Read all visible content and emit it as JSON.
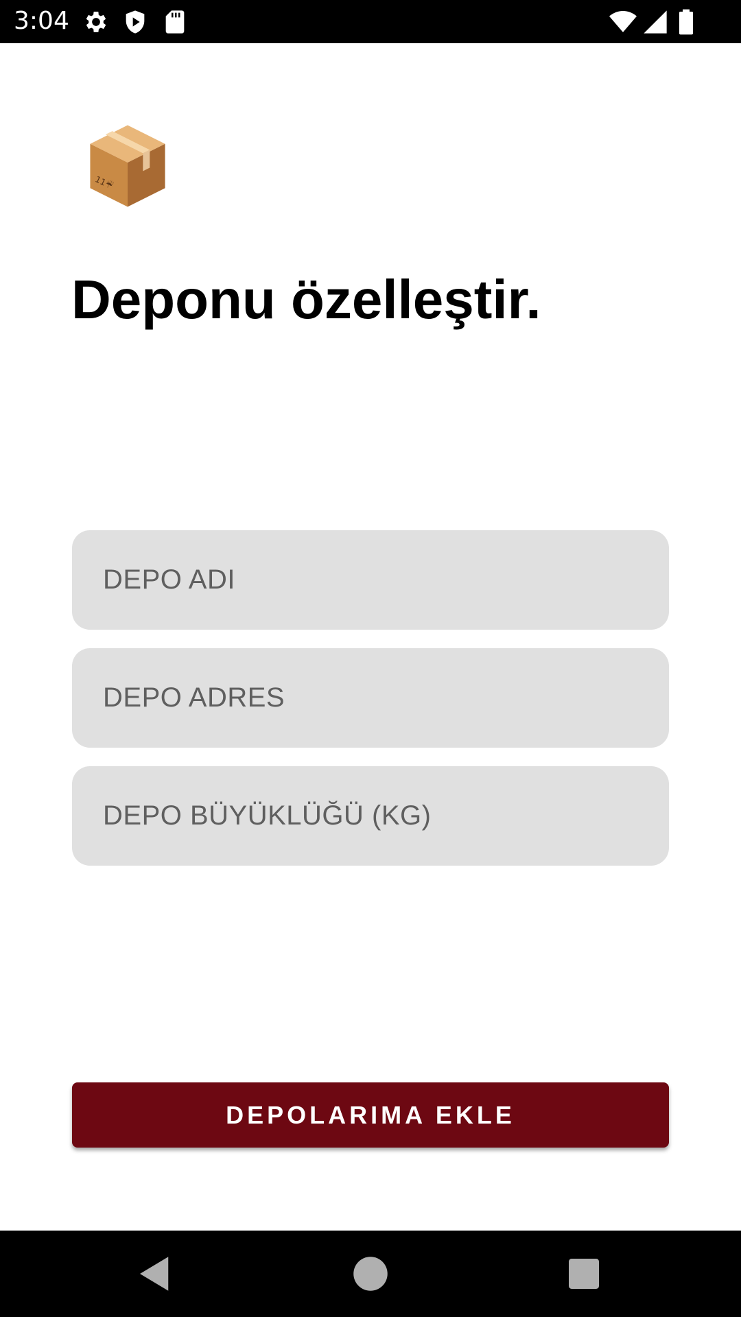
{
  "status_bar": {
    "time": "3:04",
    "icons": [
      "settings-icon",
      "shield-play-icon",
      "sd-card-icon",
      "wifi-icon",
      "cell-signal-icon",
      "battery-icon"
    ]
  },
  "header": {
    "emoji_icon": "package-box-icon",
    "title": "Deponu özelleştir."
  },
  "form": {
    "fields": [
      {
        "name": "depo-adi",
        "placeholder": "DEPO ADI",
        "value": ""
      },
      {
        "name": "depo-adres",
        "placeholder": "DEPO ADRES",
        "value": ""
      },
      {
        "name": "depo-buyuklugu",
        "placeholder": "DEPO BÜYÜKLÜĞÜ (KG)",
        "value": ""
      }
    ],
    "submit_label": "DEPOLARIMA EKLE"
  },
  "nav_bar": {
    "buttons": [
      "back-icon",
      "home-icon",
      "recents-icon"
    ]
  },
  "colors": {
    "accent": "#6d0812",
    "field_background": "#e0e0e0",
    "placeholder": "#5f5f5f"
  }
}
